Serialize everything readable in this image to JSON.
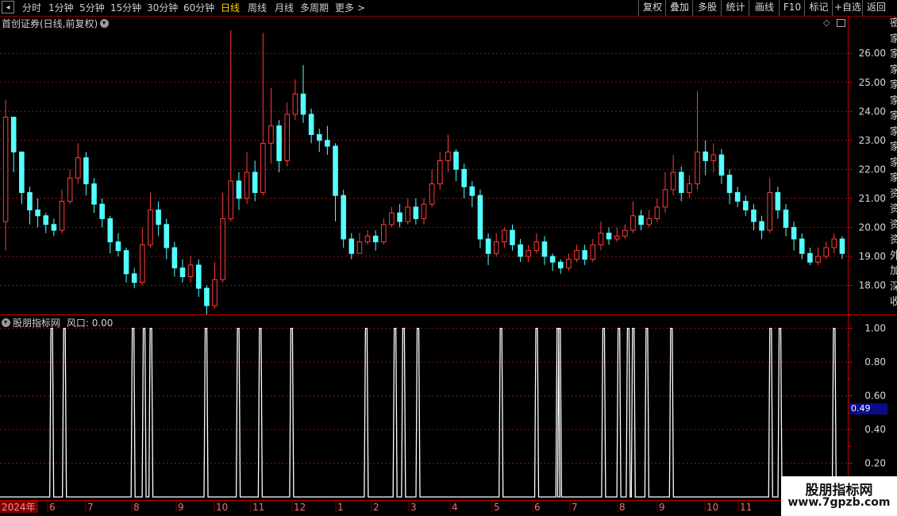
{
  "toolbar": {
    "period_buttons": [
      "分时",
      "1分钟",
      "5分钟",
      "15分钟",
      "30分钟",
      "60分钟",
      "日线",
      "周线",
      "月线",
      "多周期",
      "更多 >"
    ],
    "active_period": "日线",
    "right_buttons": [
      "复权",
      "叠加",
      "多股",
      "统计",
      "画线",
      "F10",
      "标记",
      "+自选",
      "返回"
    ]
  },
  "main_chart": {
    "title": "首创证券(日线,前复权)",
    "price_ticks": [
      "26.00",
      "25.00",
      "24.00",
      "23.00",
      "22.00",
      "21.00",
      "20.00",
      "19.00",
      "18.00"
    ]
  },
  "indicator": {
    "title": "股朋指标网",
    "line_label": "风口: 0.00",
    "ticks": [
      "1.00",
      "0.80",
      "0.60",
      "0.40",
      "0.20"
    ],
    "current_value": "0.49"
  },
  "right_sidebar_chars": [
    "密",
    "家",
    "家",
    "家",
    "家",
    "家",
    "家",
    "家",
    "家",
    "家",
    "家",
    "资",
    "资",
    "资",
    "资",
    "外",
    "加",
    "深",
    "收"
  ],
  "x_axis": {
    "year_label": "2024年",
    "month_labels": [
      "6",
      "7",
      "8",
      "9",
      "10",
      "11",
      "12",
      "1",
      "2",
      "3",
      "4",
      "5",
      "6",
      "7",
      "8",
      "9",
      "10",
      "11"
    ]
  },
  "chart_data": {
    "type": "candlestick",
    "title": "首创证券(日线,前复权)",
    "price_range": [
      17.0,
      26.8
    ],
    "colors": {
      "up": "#ff3c3c",
      "down": "#54ffff",
      "signal": "#ffffff",
      "grid": "#9a1010"
    },
    "candles": [
      [
        20.2,
        23.8,
        24.4,
        19.2
      ],
      [
        23.8,
        22.6,
        23.4,
        21.9
      ],
      [
        22.6,
        21.2,
        22.3,
        20.8
      ],
      [
        21.2,
        20.6,
        21.4,
        20.1
      ],
      [
        20.6,
        20.4,
        21.0,
        20.0
      ],
      [
        20.4,
        20.1,
        20.5,
        19.8
      ],
      [
        20.1,
        19.9,
        20.3,
        19.7
      ],
      [
        19.9,
        20.9,
        21.3,
        19.8
      ],
      [
        20.9,
        21.7,
        22.0,
        20.8
      ],
      [
        21.7,
        22.4,
        22.9,
        21.5
      ],
      [
        22.4,
        21.5,
        22.6,
        21.1
      ],
      [
        21.5,
        20.8,
        21.7,
        20.5
      ],
      [
        20.8,
        20.3,
        21.0,
        20.0
      ],
      [
        20.3,
        19.5,
        20.4,
        19.1
      ],
      [
        19.5,
        19.2,
        19.8,
        19.0
      ],
      [
        19.2,
        18.4,
        19.3,
        18.1
      ],
      [
        18.4,
        18.1,
        18.6,
        17.9
      ],
      [
        18.1,
        19.4,
        20.0,
        18.0
      ],
      [
        19.4,
        20.6,
        21.2,
        19.3
      ],
      [
        20.6,
        20.1,
        20.9,
        19.7
      ],
      [
        20.1,
        19.3,
        20.3,
        18.9
      ],
      [
        19.3,
        18.6,
        19.5,
        18.3
      ],
      [
        18.6,
        18.3,
        18.9,
        18.1
      ],
      [
        18.3,
        18.7,
        19.0,
        18.1
      ],
      [
        18.7,
        17.9,
        18.9,
        17.6
      ],
      [
        17.9,
        17.3,
        18.0,
        17.0
      ],
      [
        17.3,
        18.2,
        18.8,
        17.2
      ],
      [
        18.2,
        20.3,
        21.2,
        18.1
      ],
      [
        20.3,
        21.6,
        26.8,
        20.2
      ],
      [
        21.6,
        21.0,
        21.9,
        20.6
      ],
      [
        21.0,
        21.9,
        22.6,
        20.8
      ],
      [
        21.9,
        21.2,
        22.3,
        20.9
      ],
      [
        21.2,
        22.9,
        26.7,
        21.1
      ],
      [
        22.9,
        23.5,
        24.8,
        22.2
      ],
      [
        23.5,
        22.3,
        23.7,
        21.9
      ],
      [
        22.3,
        23.9,
        24.3,
        22.1
      ],
      [
        23.9,
        24.6,
        25.1,
        23.7
      ],
      [
        24.6,
        23.9,
        25.6,
        23.6
      ],
      [
        23.9,
        23.2,
        24.1,
        22.9
      ],
      [
        23.2,
        23.0,
        23.4,
        22.6
      ],
      [
        23.0,
        22.8,
        23.5,
        22.5
      ],
      [
        22.8,
        21.1,
        22.9,
        20.2
      ],
      [
        21.1,
        19.6,
        21.3,
        19.3
      ],
      [
        19.6,
        19.1,
        19.8,
        18.9
      ],
      [
        19.1,
        19.5,
        19.8,
        19.2
      ],
      [
        19.5,
        19.7,
        19.9,
        19.4
      ],
      [
        19.7,
        19.5,
        19.9,
        19.2
      ],
      [
        19.5,
        20.1,
        20.3,
        19.4
      ],
      [
        20.1,
        20.5,
        20.7,
        20.0
      ],
      [
        20.5,
        20.2,
        20.8,
        20.0
      ],
      [
        20.2,
        20.7,
        21.0,
        20.1
      ],
      [
        20.7,
        20.3,
        21.0,
        20.1
      ],
      [
        20.3,
        20.8,
        21.0,
        20.1
      ],
      [
        20.8,
        21.5,
        22.0,
        20.7
      ],
      [
        21.5,
        22.3,
        22.6,
        21.3
      ],
      [
        22.3,
        22.6,
        23.2,
        21.9
      ],
      [
        22.6,
        22.0,
        22.7,
        21.6
      ],
      [
        22.0,
        21.4,
        22.2,
        21.0
      ],
      [
        21.4,
        21.1,
        21.6,
        20.7
      ],
      [
        21.1,
        19.6,
        21.3,
        19.3
      ],
      [
        19.6,
        19.1,
        19.8,
        18.7
      ],
      [
        19.1,
        19.5,
        19.8,
        19.0
      ],
      [
        19.5,
        19.9,
        20.0,
        19.3
      ],
      [
        19.9,
        19.4,
        20.1,
        19.2
      ],
      [
        19.4,
        19.0,
        19.6,
        18.8
      ],
      [
        19.0,
        19.2,
        19.4,
        18.8
      ],
      [
        19.2,
        19.5,
        19.8,
        19.1
      ],
      [
        19.5,
        19.0,
        19.7,
        18.7
      ],
      [
        19.0,
        18.8,
        19.1,
        18.5
      ],
      [
        18.8,
        18.6,
        18.9,
        18.4
      ],
      [
        18.6,
        18.9,
        19.1,
        18.5
      ],
      [
        18.9,
        19.2,
        19.4,
        18.8
      ],
      [
        19.2,
        18.9,
        19.4,
        18.7
      ],
      [
        18.9,
        19.4,
        19.6,
        18.8
      ],
      [
        19.4,
        19.8,
        20.2,
        19.2
      ],
      [
        19.8,
        19.6,
        20.0,
        19.4
      ],
      [
        19.6,
        19.7,
        20.0,
        19.5
      ],
      [
        19.7,
        19.9,
        20.1,
        19.6
      ],
      [
        19.9,
        20.4,
        20.9,
        19.8
      ],
      [
        20.4,
        20.1,
        20.6,
        19.9
      ],
      [
        20.1,
        20.3,
        20.6,
        20.0
      ],
      [
        20.3,
        20.7,
        21.0,
        20.2
      ],
      [
        20.7,
        21.3,
        21.9,
        20.5
      ],
      [
        21.3,
        21.9,
        22.5,
        21.1
      ],
      [
        21.9,
        21.2,
        22.1,
        20.9
      ],
      [
        21.2,
        21.5,
        21.8,
        21.0
      ],
      [
        21.5,
        22.6,
        24.7,
        21.3
      ],
      [
        22.6,
        22.3,
        23.0,
        21.8
      ],
      [
        22.3,
        22.5,
        22.9,
        21.9
      ],
      [
        22.5,
        21.8,
        22.7,
        21.5
      ],
      [
        21.8,
        21.2,
        22.0,
        20.8
      ],
      [
        21.2,
        20.9,
        21.4,
        20.7
      ],
      [
        20.9,
        20.6,
        21.1,
        20.4
      ],
      [
        20.6,
        20.2,
        20.8,
        19.9
      ],
      [
        20.2,
        19.9,
        20.4,
        19.6
      ],
      [
        19.9,
        21.2,
        21.7,
        19.8
      ],
      [
        21.2,
        20.6,
        21.4,
        20.3
      ],
      [
        20.6,
        20.0,
        20.8,
        19.7
      ],
      [
        20.0,
        19.6,
        20.2,
        19.2
      ],
      [
        19.6,
        19.1,
        19.8,
        18.9
      ],
      [
        19.1,
        18.8,
        19.3,
        18.7
      ],
      [
        18.8,
        19.0,
        19.3,
        18.7
      ],
      [
        19.0,
        19.3,
        19.5,
        18.9
      ],
      [
        19.3,
        19.6,
        19.8,
        19.1
      ],
      [
        19.6,
        19.1,
        19.7,
        18.9
      ]
    ],
    "signal_series": {
      "name": "风口",
      "ylim": [
        0,
        1.05
      ],
      "current": 0.49,
      "spike_positions_fraction": [
        0.061,
        0.076,
        0.157,
        0.17,
        0.178,
        0.243,
        0.281,
        0.307,
        0.344,
        0.432,
        0.466,
        0.476,
        0.493,
        0.591,
        0.633,
        0.658,
        0.66,
        0.712,
        0.73,
        0.741,
        0.747,
        0.763,
        0.792,
        0.909,
        0.92,
        0.984
      ]
    }
  }
}
